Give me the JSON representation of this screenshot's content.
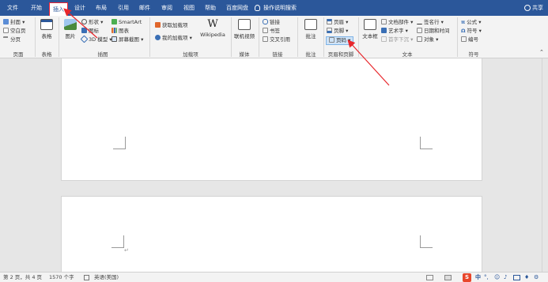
{
  "tabs": [
    {
      "label": "文件"
    },
    {
      "label": "开始"
    },
    {
      "label": "插入"
    },
    {
      "label": "设计"
    },
    {
      "label": "布局"
    },
    {
      "label": "引用"
    },
    {
      "label": "邮件"
    },
    {
      "label": "审阅"
    },
    {
      "label": "视图"
    },
    {
      "label": "帮助"
    },
    {
      "label": "百度网盘"
    }
  ],
  "tell_me": "操作说明搜索",
  "share": "共享",
  "ribbon": {
    "pages": {
      "cover": "封面",
      "blank": "空白页",
      "break": "分页",
      "label": "页面"
    },
    "tables": {
      "table": "表格",
      "label": "表格"
    },
    "illustrations": {
      "picture": "图片",
      "shapes": "形状",
      "icons": "图标",
      "model3d": "3D 模型",
      "smartart": "SmartArt",
      "chart": "图表",
      "screenshot": "屏幕截图",
      "label": "插图"
    },
    "addins": {
      "get": "获取加载项",
      "my": "我的加载项",
      "wiki": "Wikipedia",
      "label": "加载项"
    },
    "media": {
      "video": "联机视频",
      "label": "媒体"
    },
    "links": {
      "link": "链接",
      "bookmark": "书签",
      "crossref": "交叉引用",
      "label": "链接"
    },
    "comments": {
      "comment": "批注",
      "label": "批注"
    },
    "header_footer": {
      "header": "页眉",
      "footer": "页脚",
      "page_number": "页码",
      "label": "页眉和页脚"
    },
    "text": {
      "textbox": "文本框",
      "quickparts": "文档部件",
      "wordart": "艺术字",
      "dropcap": "首字下沉",
      "signature": "签名行",
      "datetime": "日期和时间",
      "object": "对象",
      "label": "文本"
    },
    "symbols": {
      "equation": "公式",
      "symbol": "符号",
      "number": "编号",
      "label": "符号"
    }
  },
  "status": {
    "page": "第 2 页，共 4 页",
    "words": "1570 个字",
    "language": "英语(美国)"
  },
  "ime": {
    "s": "S",
    "zh": "中"
  },
  "colors": {
    "accent": "#2b579a",
    "annotation": "#e8262b"
  }
}
